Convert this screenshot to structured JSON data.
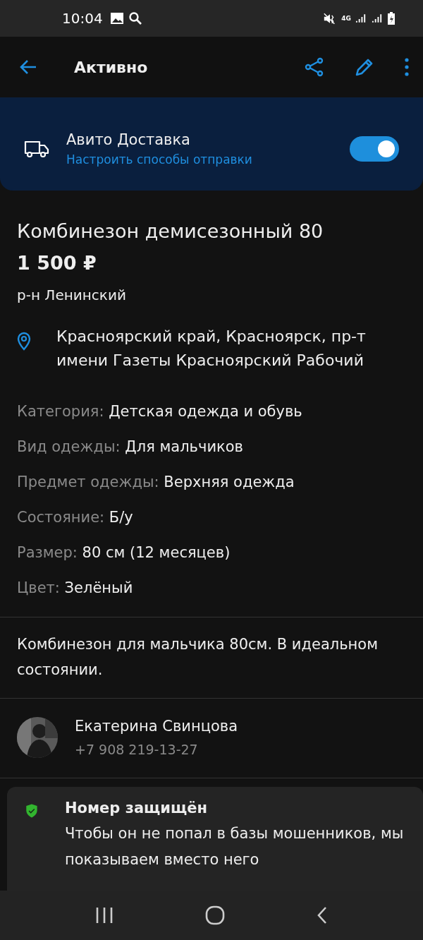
{
  "status_bar": {
    "time": "10:04",
    "network": "4G"
  },
  "app_bar": {
    "title": "Активно"
  },
  "delivery_card": {
    "title": "Авито Доставка",
    "link": "Настроить способы отправки",
    "on": true
  },
  "listing": {
    "title": "Комбинезон демисезонный 80",
    "price": "1 500 ₽",
    "district": "р-н Ленинский",
    "address": "Красноярский край, Красноярск, пр-т имени Газеты Красноярский Рабочий"
  },
  "attributes": [
    {
      "label": "Категория:",
      "value": "Детская одежда и обувь"
    },
    {
      "label": "Вид одежды:",
      "value": "Для мальчиков"
    },
    {
      "label": "Предмет одежды:",
      "value": "Верхняя одежда"
    },
    {
      "label": "Состояние:",
      "value": "Б/у"
    },
    {
      "label": "Размер:",
      "value": "80 см (12 месяцев)"
    },
    {
      "label": "Цвет:",
      "value": "Зелёный"
    }
  ],
  "description": "Комбинезон для мальчика 80см. В идеальном состоянии.",
  "seller": {
    "name": "Екатерина Свинцова",
    "phone": "+7 908 219-13-27"
  },
  "notice": {
    "title": "Номер защищён",
    "text": "Чтобы он не попал в базы мошенников, мы показываем вместо него"
  }
}
